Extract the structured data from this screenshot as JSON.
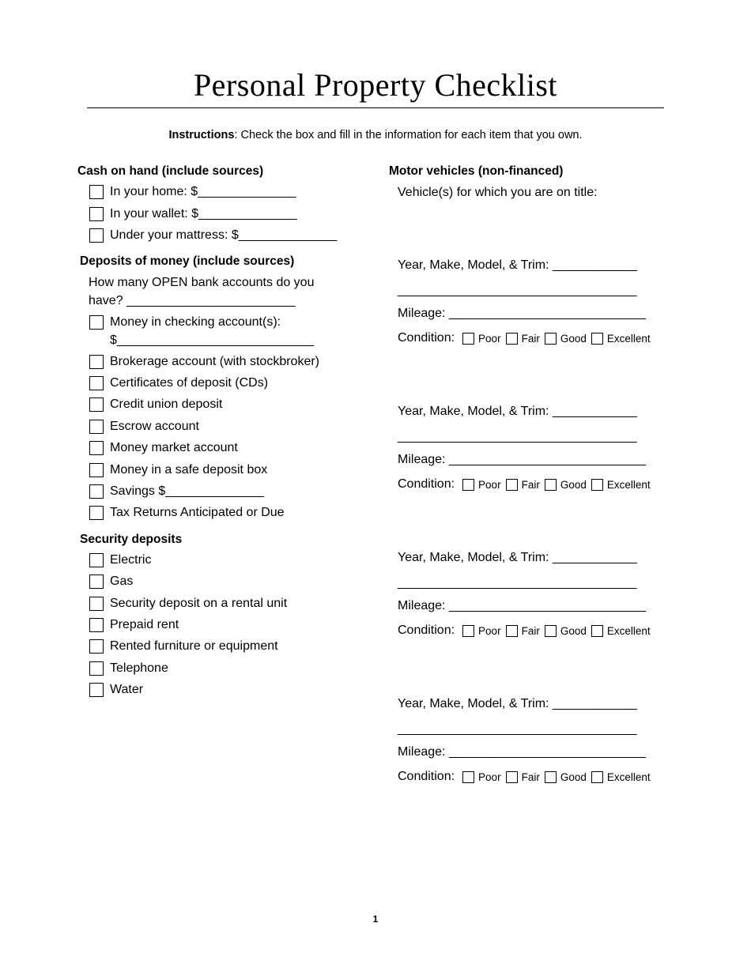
{
  "title": "Personal Property Checklist",
  "instructions": {
    "bold": "Instructions",
    "text": ": Check the box and fill in the information for each item that you own."
  },
  "cash": {
    "heading": "Cash on hand (include sources)",
    "items": [
      "In your home: $______________",
      "In your wallet: $______________",
      "Under your mattress: $______________"
    ]
  },
  "deposits": {
    "heading": "Deposits of money (include sources)",
    "question_line1": "How many OPEN bank accounts do you",
    "question_line2": "have?  ________________________",
    "checking_line1": "Money in checking account(s):",
    "checking_line2": "$____________________________",
    "items": [
      "Brokerage account (with stockbroker)",
      "Certificates of deposit (CDs)",
      "Credit union deposit",
      "Escrow account",
      "Money market account",
      "Money in a safe deposit box",
      "Savings $______________",
      "Tax Returns Anticipated or Due"
    ]
  },
  "security": {
    "heading": "Security deposits",
    "items": [
      "Electric",
      "Gas",
      "Security deposit on a rental unit",
      "Prepaid rent",
      "Rented furniture or equipment",
      "Telephone",
      "Water"
    ]
  },
  "vehicles": {
    "heading": "Motor vehicles (non-financed)",
    "subtitle": "Vehicle(s) for which you are on title:",
    "ymmt_label": "Year, Make, Model, & Trim: ____________",
    "blank_line": "__________________________________",
    "mileage_label": "Mileage:  ____________________________",
    "condition_label": "Condition:",
    "condition_options": [
      "Poor",
      "Fair",
      "Good",
      "Excellent"
    ]
  },
  "page_number": "1"
}
